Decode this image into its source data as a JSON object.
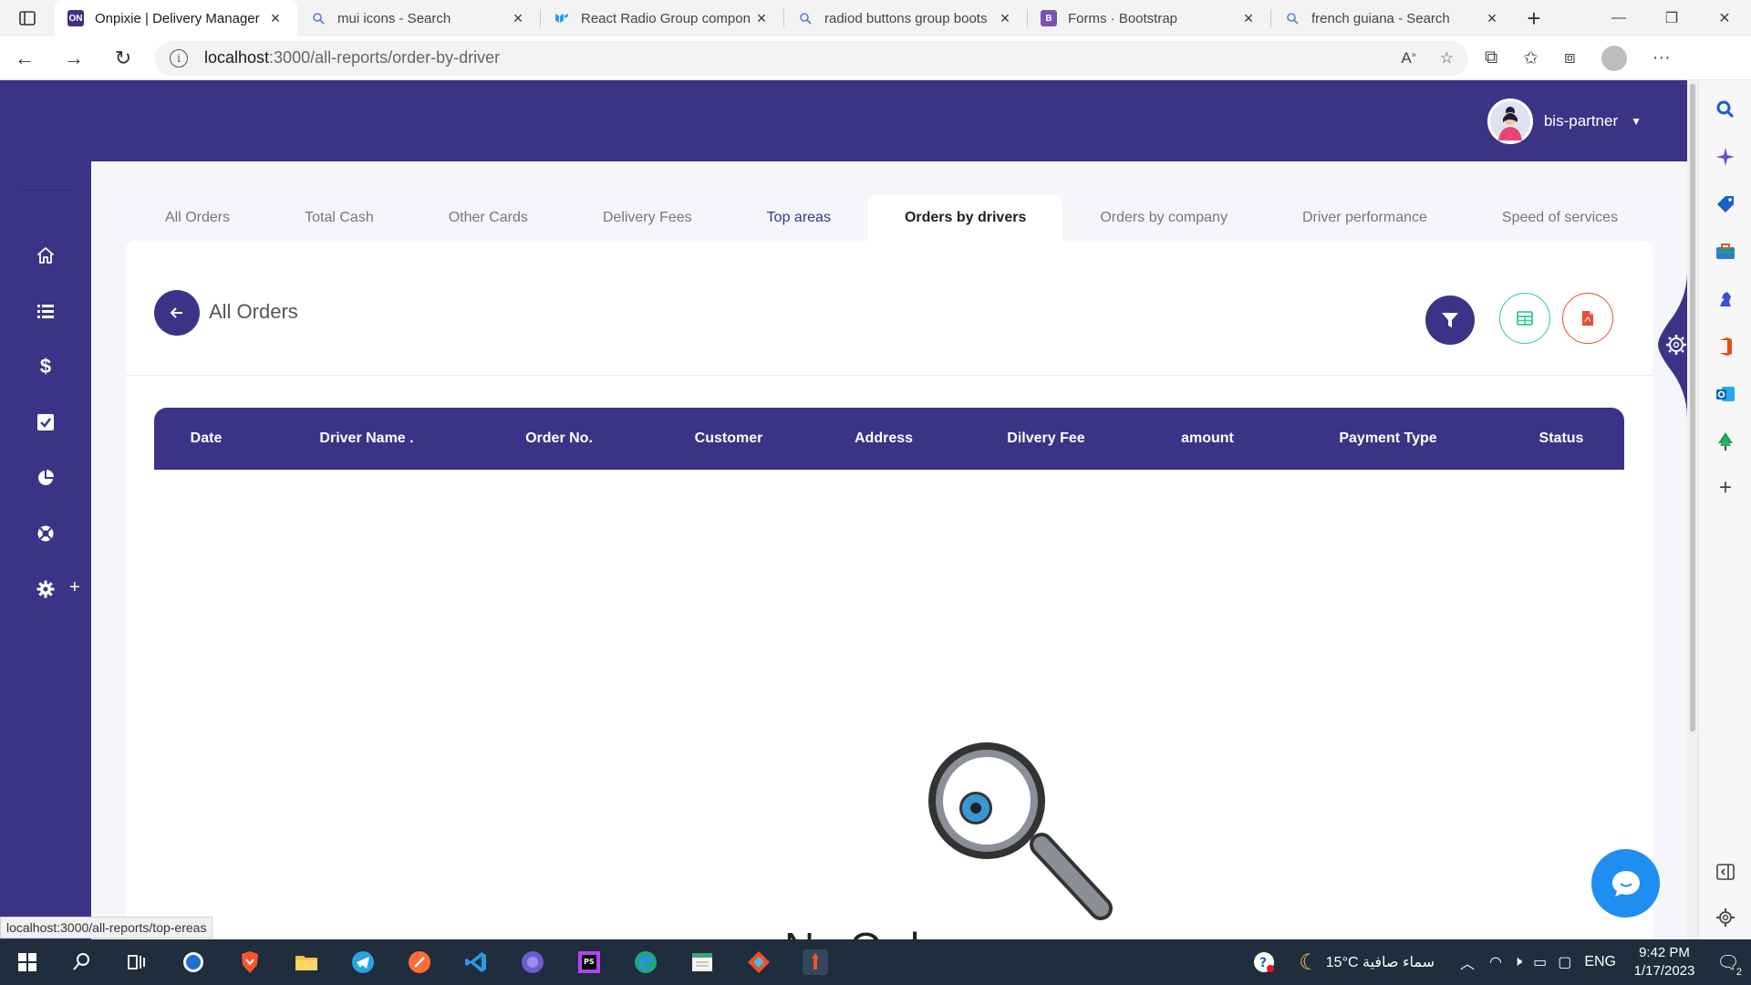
{
  "browser": {
    "tabs": [
      {
        "title": "Onpixie | Delivery Manager",
        "favicon": "ON",
        "active": true
      },
      {
        "title": "mui icons - Search",
        "favicon": "search-icon",
        "active": false
      },
      {
        "title": "React Radio Group compon",
        "favicon": "mui-logo",
        "active": false
      },
      {
        "title": "radiod buttons group boots",
        "favicon": "search-icon",
        "active": false
      },
      {
        "title": "Forms · Bootstrap",
        "favicon": "B",
        "active": false
      },
      {
        "title": "french guiana - Search",
        "favicon": "search-icon",
        "active": false
      }
    ],
    "url_host": "localhost",
    "url_path": ":3000/all-reports/order-by-driver",
    "status_url": "localhost:3000/all-reports/top-ereas"
  },
  "app": {
    "colors": {
      "primary": "#3b3486",
      "excel": "#32c9a0",
      "pdf": "#e74c3c",
      "chat": "#1f8ef1"
    },
    "user": {
      "name": "bis-partner"
    },
    "report_tabs": [
      {
        "label": "All Orders",
        "state": "normal"
      },
      {
        "label": "Total Cash",
        "state": "normal"
      },
      {
        "label": "Other Cards",
        "state": "normal"
      },
      {
        "label": "Delivery Fees",
        "state": "normal"
      },
      {
        "label": "Top areas",
        "state": "hover"
      },
      {
        "label": "Orders by drivers",
        "state": "active"
      },
      {
        "label": "Orders by company",
        "state": "normal"
      },
      {
        "label": "Driver performance",
        "state": "normal"
      },
      {
        "label": "Speed of services",
        "state": "normal"
      }
    ],
    "card_title": "All Orders",
    "table_headers": [
      "Date",
      "Driver Name .",
      "Order No.",
      "Customer",
      "Address",
      "Dilvery Fee",
      "amount",
      "Payment Type",
      "Status"
    ],
    "empty_text": "No Orders"
  },
  "taskbar": {
    "weather": "15°C  سماء صافية",
    "lang": "ENG",
    "time": "9:42 PM",
    "date": "1/17/2023",
    "notif_count": "2"
  }
}
